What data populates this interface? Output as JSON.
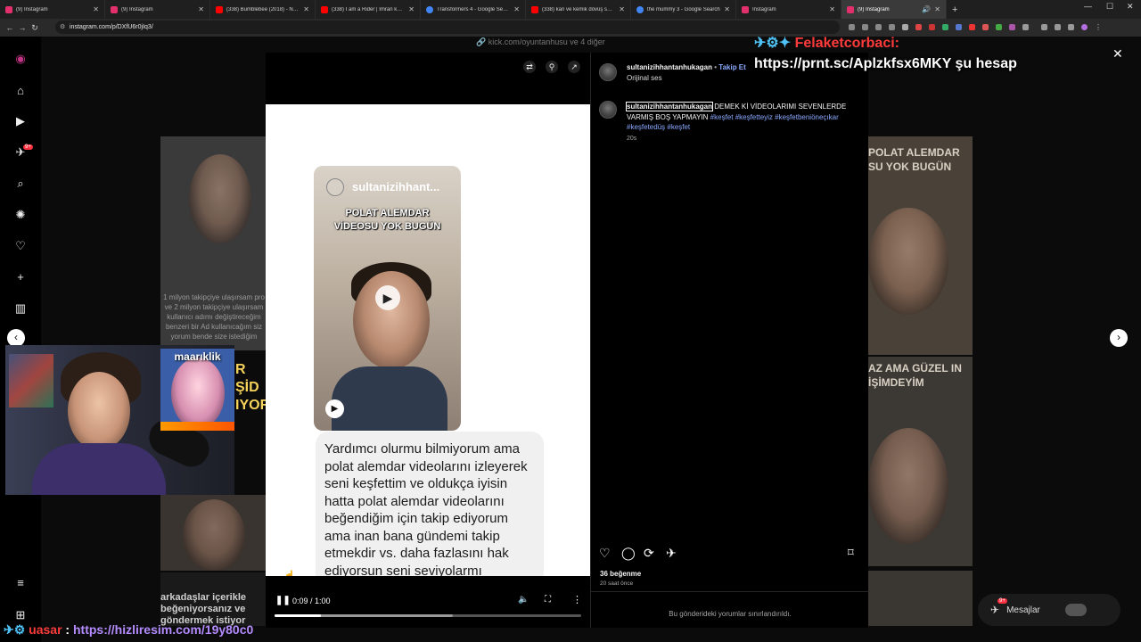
{
  "browser": {
    "tabs": [
      {
        "label": "(9) Instagram",
        "color": "#e1306c"
      },
      {
        "label": "(9) Instagram",
        "color": "#e1306c"
      },
      {
        "label": "(338) Bumblebee (2018) - New",
        "color": "#ff0000"
      },
      {
        "label": "(338) I am a Rider | Imran khan",
        "color": "#ff0000"
      },
      {
        "label": "Transformers 4 - Google Search",
        "color": "#4285f4"
      },
      {
        "label": "(338) kan ve kemik dövüş sahnes",
        "color": "#ff0000"
      },
      {
        "label": "the mummy 3 - Google Search",
        "color": "#4285f4"
      },
      {
        "label": "Instagram",
        "color": "#e1306c"
      },
      {
        "label": "(9) Instagram",
        "color": "#e1306c"
      }
    ],
    "url": "instagram.com/p/DXfU6r0jIq3/"
  },
  "sidebar": {
    "notif_badge": "9+"
  },
  "background_texts": {
    "left_caption": "1 milyon takipçiye ulaşırsam pro ve 2 milyon takipçiye ulaşırsam kullanıcı adımı değiştireceğim benzeri bir Ad kullanıcağım siz yorum bende size istediğim",
    "left_bottom": "arkadaşlar içerikle beğeniyorsanız ve göndermek istiyor",
    "right_top": "POLAT ALEMDAR SU YOK BUGÜN",
    "right_mid": "AZ AMA GÜZEL IN İŞİMDEYİM",
    "top_link": "kick.com/oyuntanhusu ve 4 diğer",
    "left_mid": "R ŞİD IYOR"
  },
  "reel": {
    "username": "sultanizihhant...",
    "headline": "POLAT ALEMDAR VİDEOSU YOK BUGÜN"
  },
  "chat": {
    "message": "Yardımcı olurmu bilmiyorum ama polat alemdar videolarını izleyerek seni keşfettim ve oldukça iyisin hatta polat alemdar videolarını beğendiğim için takip ediyorum ama inan bana gündemi takip etmekdir vs. daha fazlasını hak ediyorsun seni seviyolarmı bilemem ama ben seni destekliyorum",
    "emojis": "🤝🤝🤝"
  },
  "player": {
    "time": "0:09 / 1:00",
    "progress": 0.15
  },
  "post": {
    "username": "sultanizihhantanhukagan",
    "follow_label": "Takip Et",
    "audio_label": "Orijinal ses",
    "caption_text": "DEMEK Kİ VİDEOLARIMI SEVENLERDE VARMIŞ BOŞ YAPMAYIN",
    "hashtags": "#keşfet #keşfetteyiz #keşfetbeniöneçıkar #keşfetedüş #keşfet",
    "caption_age": "20s",
    "likes": "36 beğenme",
    "posted": "20 saat önce",
    "comments_limited": "Bu gönderideki yorumlar sınırlandırıldı."
  },
  "overlay": {
    "chat_user": "Felaketcorbaci:",
    "chat_message": "https://prnt.sc/Aplzkfsx6MKY şu hesap",
    "bottom_user": "uasar",
    "bottom_message": "https://hizliresim.com/19y80c0",
    "webcam_tag": "maarıklik"
  },
  "messages_button": {
    "label": "Mesajlar",
    "badge": "9+"
  },
  "colors": {
    "accent_link": "#8aa9ff",
    "overlay_red": "#ff3b3b",
    "bottom_link": "#b48cff"
  }
}
